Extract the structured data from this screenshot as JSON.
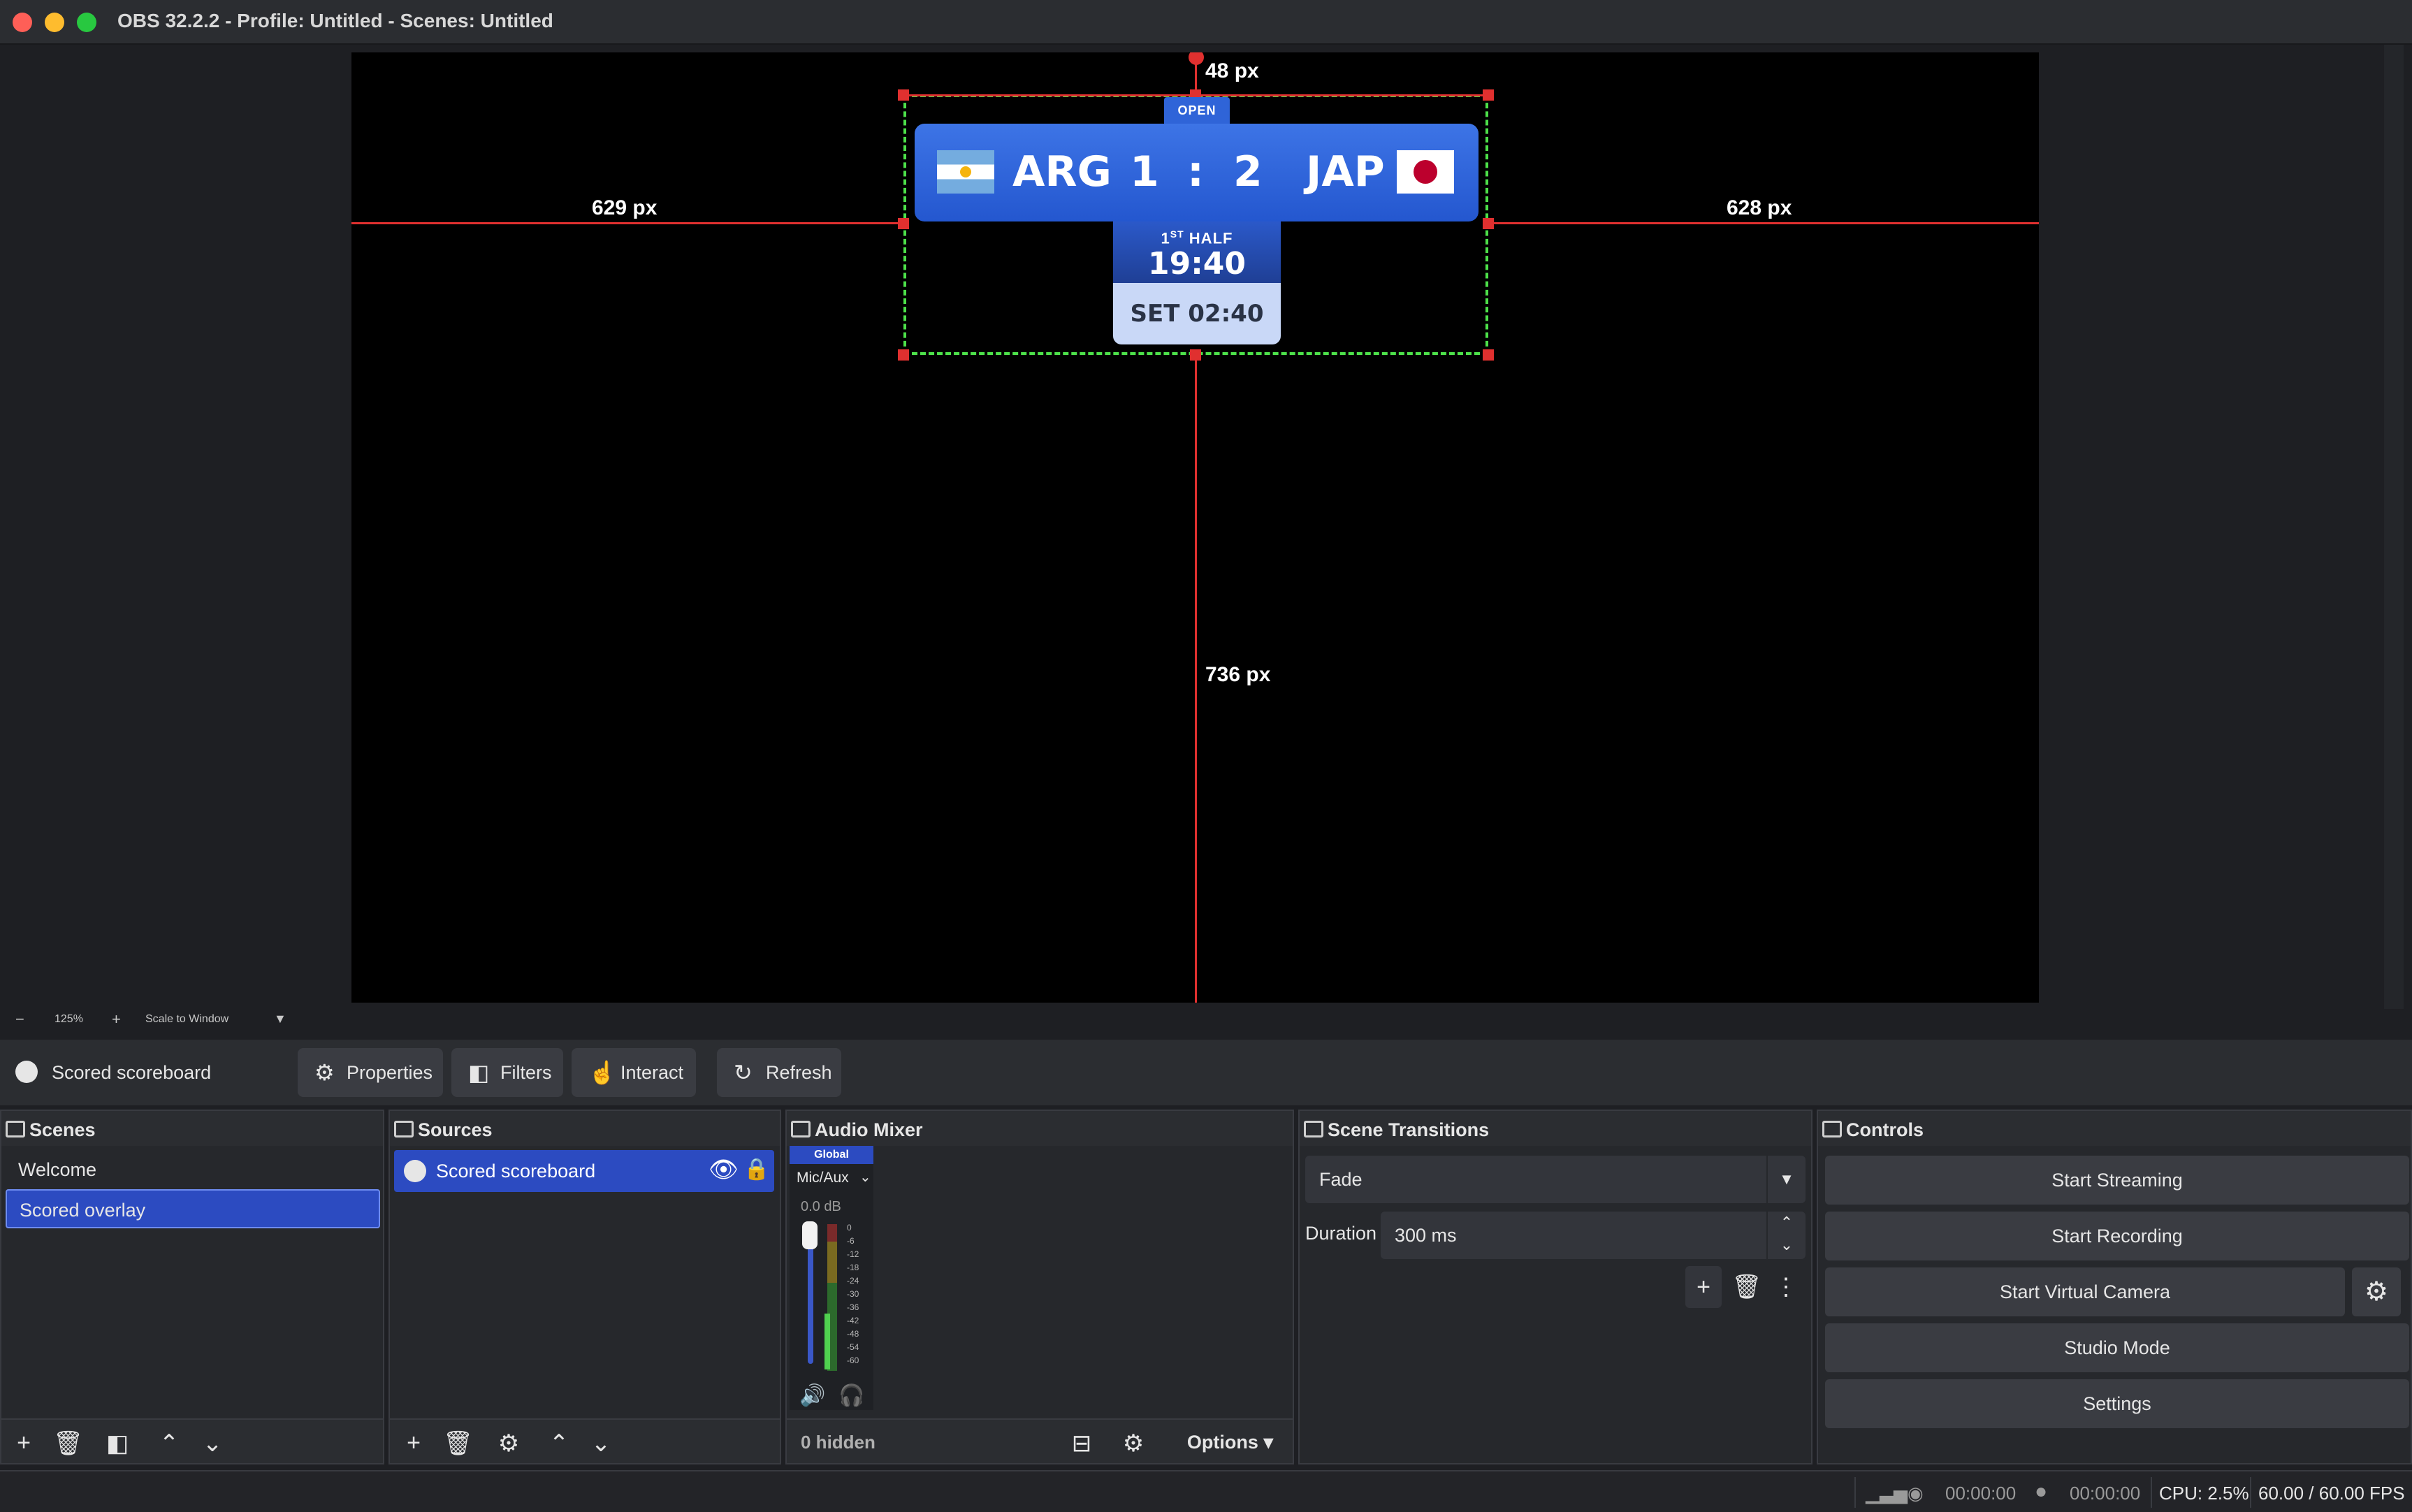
{
  "window": {
    "title": "OBS 32.2.2 - Profile: Untitled - Scenes: Untitled"
  },
  "preview": {
    "guides": {
      "top": "48 px",
      "left": "629 px",
      "right": "628 px",
      "bottom": "736 px"
    },
    "scoreboard": {
      "badge": "OPEN",
      "team_left": "ARG",
      "score_left": "1",
      "separator": ":",
      "score_right": "2",
      "team_right": "JAP",
      "half_number": "1",
      "half_suffix": "ST",
      "half_word": "HALF",
      "clock": "19:40",
      "set_time": "SET 02:40"
    },
    "zoom": {
      "minus": "−",
      "level": "125%",
      "plus": "+",
      "mode": "Scale to Window"
    }
  },
  "context_bar": {
    "source_name": "Scored scoreboard",
    "properties": "Properties",
    "filters": "Filters",
    "interact": "Interact",
    "refresh": "Refresh"
  },
  "scenes": {
    "title": "Scenes",
    "items": [
      "Welcome",
      "Scored overlay"
    ],
    "selected": "Scored overlay"
  },
  "sources": {
    "title": "Sources",
    "items": [
      "Scored scoreboard"
    ]
  },
  "audio_mixer": {
    "title": "Audio Mixer",
    "global_label": "Global",
    "channel": "Mic/Aux",
    "level": "0.0 dB",
    "scale": [
      "0",
      "-6",
      "-12",
      "-18",
      "-24",
      "-30",
      "-36",
      "-42",
      "-48",
      "-54",
      "-60"
    ],
    "hidden": "0 hidden",
    "options": "Options"
  },
  "scene_transitions": {
    "title": "Scene Transitions",
    "transition": "Fade",
    "duration_label": "Duration",
    "duration_value": "300 ms"
  },
  "controls": {
    "title": "Controls",
    "start_streaming": "Start Streaming",
    "start_recording": "Start Recording",
    "start_virtual_camera": "Start Virtual Camera",
    "studio_mode": "Studio Mode",
    "settings": "Settings"
  },
  "status": {
    "stream_time": "00:00:00",
    "record_time": "00:00:00",
    "cpu": "CPU: 2.5%",
    "fps": "60.00 / 60.00 FPS"
  },
  "colors": {
    "accent": "#2c4bc1",
    "guide_red": "#e0302f",
    "bbox_green": "#4de14a"
  }
}
